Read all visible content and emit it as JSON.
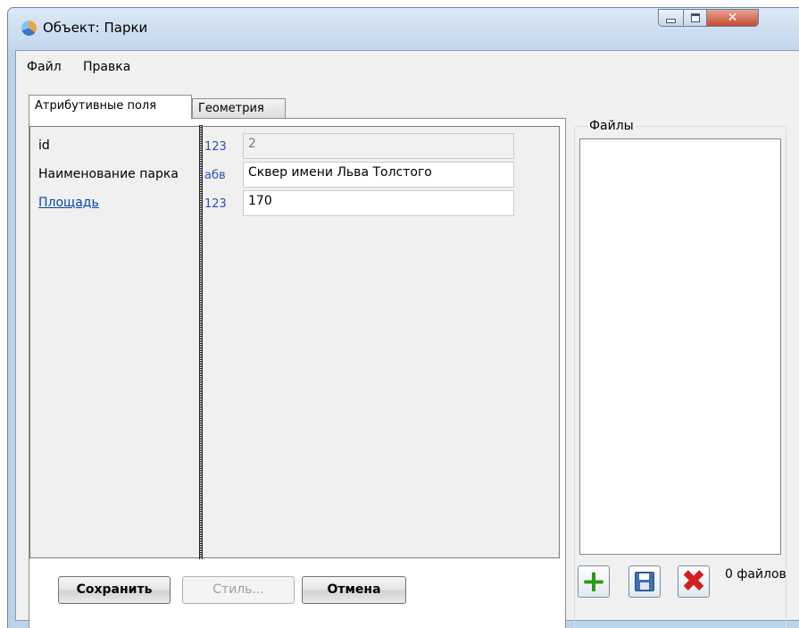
{
  "window": {
    "title": "Объект: Парки",
    "controls": {
      "minimize_icon": "minimize-icon",
      "maximize_icon": "maximize-icon",
      "close_icon": "close-icon"
    }
  },
  "menu": {
    "items": [
      {
        "label": "Файл"
      },
      {
        "label": "Правка"
      }
    ]
  },
  "tabs": [
    {
      "label": "Атрибутивные поля",
      "active": true
    },
    {
      "label": "Геометрия",
      "active": false
    }
  ],
  "attributes": [
    {
      "label": "id",
      "type": "123",
      "value": "2",
      "editable": false,
      "is_link": false
    },
    {
      "label": "Наименование парка",
      "type": "абв",
      "value": "Сквер имени Льва Толстого",
      "editable": true,
      "is_link": false
    },
    {
      "label": "Площадь",
      "type": "123",
      "value": "170",
      "editable": true,
      "is_link": true
    }
  ],
  "buttons": {
    "save": "Сохранить",
    "style": "Стиль...",
    "cancel": "Отмена"
  },
  "files": {
    "legend": "Файлы",
    "count_label": "0 файлов",
    "actions": {
      "add_icon": "add-file-icon",
      "save_icon": "save-file-icon",
      "delete_icon": "delete-file-icon"
    }
  },
  "colors": {
    "link": "#0645ad",
    "type_indicator": "#2c4fb5",
    "add_green": "#2a9a16",
    "delete_red": "#d21f1f",
    "close_button": "#c74a32"
  }
}
